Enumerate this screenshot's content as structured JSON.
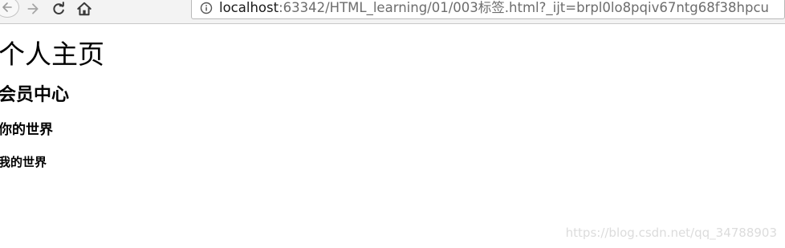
{
  "browser": {
    "url_host": "localhost",
    "url_rest": ":63342/HTML_learning/01/003标签.html?_ijt=brpl0lo8pqiv67ntg68f38hpcu"
  },
  "page": {
    "h1": "个人主页",
    "h2": "会员中心",
    "h3": "你的世界",
    "h4": "我的世界"
  },
  "watermark": "https://blog.csdn.net/qq_34788903"
}
